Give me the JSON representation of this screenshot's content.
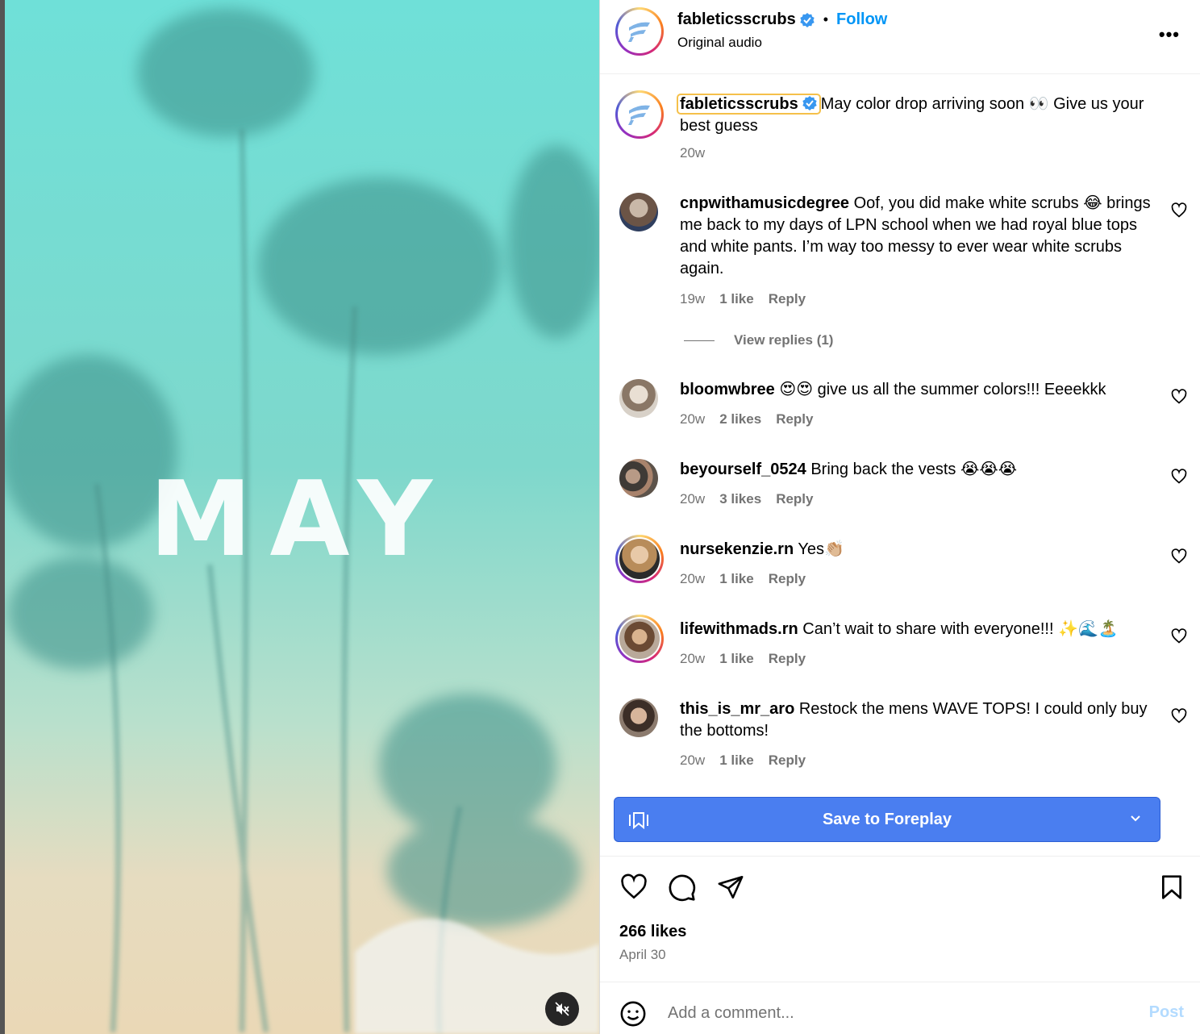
{
  "media": {
    "overlay_text": "MAY",
    "mute_icon": "muted-speaker-icon"
  },
  "header": {
    "username": "fableticsscrubs",
    "separator": "•",
    "follow_label": "Follow",
    "subtitle": "Original audio",
    "more_icon": "•••"
  },
  "caption": {
    "username": "fableticsscrubs",
    "text": "May color drop arriving soon 👀 Give us your best guess",
    "time": "20w"
  },
  "comments": [
    {
      "username": "cnpwithamusicdegree",
      "text": "Oof, you did make white scrubs 😂 brings me back to my days of LPN school when we had royal blue tops and white pants. I’m way too messy to ever wear white scrubs again.",
      "time": "19w",
      "likes": "1 like",
      "reply": "Reply"
    },
    {
      "username": "bloomwbree",
      "text": "😍😍 give us all the summer colors!!! Eeeekkk",
      "time": "20w",
      "likes": "2 likes",
      "reply": "Reply"
    },
    {
      "username": "beyourself_0524",
      "text": "Bring back the vests 😭😭😭",
      "time": "20w",
      "likes": "3 likes",
      "reply": "Reply"
    },
    {
      "username": "nursekenzie.rn",
      "text": "Yes👏🏼",
      "time": "20w",
      "likes": "1 like",
      "reply": "Reply"
    },
    {
      "username": "lifewithmads.rn",
      "text": "Can’t wait to share with everyone!!! ✨🌊🏝️",
      "time": "20w",
      "likes": "1 like",
      "reply": "Reply"
    },
    {
      "username": "this_is_mr_aro",
      "text": "Restock the mens WAVE TOPS! I could only buy the bottoms!",
      "time": "20w",
      "likes": "1 like",
      "reply": "Reply"
    }
  ],
  "view_replies": "View replies (1)",
  "save_button": {
    "label": "Save to Foreplay"
  },
  "footer": {
    "likes": "266 likes",
    "date": "April 30",
    "comment_placeholder": "Add a comment...",
    "post_label": "Post"
  },
  "colors": {
    "accent": "#0095f6",
    "save": "#4a7ef0",
    "muted": "#737373"
  }
}
